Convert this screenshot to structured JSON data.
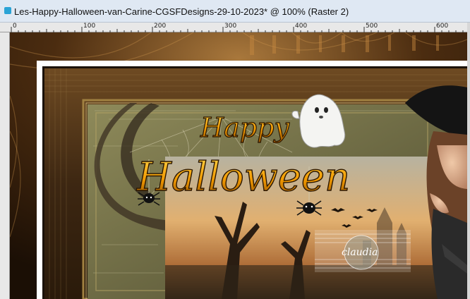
{
  "window": {
    "title": "Les-Happy-Halloween-van-Carine-CGSFDesigns-29-10-2023* @ 100% (Raster 2)"
  },
  "ruler": {
    "labels": [
      "0",
      "100",
      "200",
      "300",
      "400",
      "500",
      "600"
    ]
  },
  "artwork": {
    "headline_line1": "Happy",
    "headline_line2": "Halloween",
    "watermark": "claudia"
  },
  "colors": {
    "titlebar": "#dfe8f3",
    "canvas_bg": "#241406",
    "headline": "#f2a400",
    "frame_gold": "#a08040"
  }
}
